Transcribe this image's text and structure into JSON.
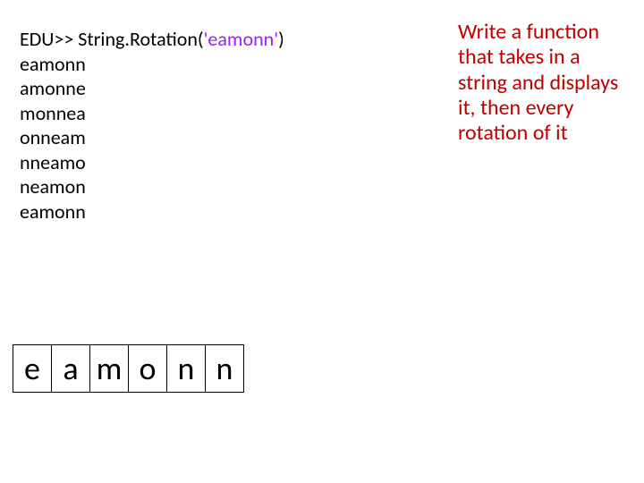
{
  "code": {
    "prompt_prefix": "EDU>> String.Rotation(",
    "arg": "'eamonn'",
    "prompt_suffix": ")",
    "output": [
      "eamonn",
      "amonne",
      "monnea",
      "onneam",
      "nneamo",
      "neamon",
      "eamonn"
    ]
  },
  "instructions": "Write a function that takes in a string and displays it, then every rotation of it",
  "cells": [
    "e",
    "a",
    "m",
    "o",
    "n",
    "n"
  ]
}
